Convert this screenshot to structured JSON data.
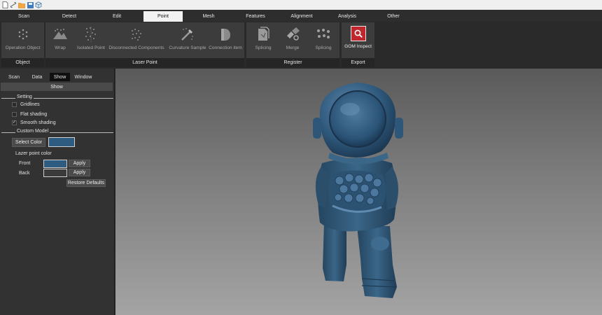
{
  "quick_access": [
    {
      "name": "new-file-icon"
    },
    {
      "name": "link-icon"
    },
    {
      "name": "open-folder-icon"
    },
    {
      "name": "save-icon"
    },
    {
      "name": "cube-icon"
    }
  ],
  "menu": {
    "tabs": [
      "Scan",
      "Detect",
      "Edit",
      "Point",
      "Mesh",
      "Features",
      "Alignment",
      "Analysis",
      "Other"
    ],
    "active": "Point"
  },
  "ribbon": {
    "groups": {
      "object": {
        "label": "Object",
        "tools": [
          {
            "label": "Operation Object",
            "icon": "operation-object-icon"
          }
        ]
      },
      "laser_point": {
        "label": "Laser Point",
        "tools": [
          {
            "label": "Wrap",
            "icon": "wrap-icon"
          },
          {
            "label": "Isolated Point",
            "icon": "isolated-point-icon"
          },
          {
            "label": "Disconnected Components",
            "icon": "disconnected-components-icon"
          },
          {
            "label": "Curvature Sample",
            "icon": "curvature-sample-icon"
          },
          {
            "label": "Connection item",
            "icon": "connection-item-icon"
          }
        ]
      },
      "register": {
        "label": "Register",
        "tools": [
          {
            "label": "Splicing",
            "icon": "splicing-doc-icon"
          },
          {
            "label": "Merge",
            "icon": "merge-icon"
          },
          {
            "label": "Splicing",
            "icon": "splicing-points-icon"
          }
        ]
      },
      "export": {
        "label": "Export",
        "tools": [
          {
            "label": "GOM Inspect",
            "icon": "gom-inspect-icon"
          }
        ]
      }
    }
  },
  "panel": {
    "tabs": [
      "Scan",
      "Data",
      "Show",
      "Window"
    ],
    "active_tab": "Show",
    "header": "Show",
    "setting": {
      "title": "Setting",
      "options": [
        {
          "label": "Gridlines",
          "checked": false
        },
        {
          "label": "Flat shading",
          "checked": false
        },
        {
          "label": "Smooth shading",
          "checked": true
        }
      ]
    },
    "custom_model": {
      "title": "Custom Model",
      "select_color_label": "Select Color",
      "model_color": "#2d5c80",
      "lazer_title": "Lazer point color",
      "front_label": "Front",
      "front_color": "#2d5c80",
      "back_label": "Back",
      "back_color": "#3a3a3a",
      "apply_label": "Apply",
      "restore_label": "Restore Defaults"
    }
  },
  "colors": {
    "model": "#2f5a7d",
    "accent_red": "#c0272d"
  }
}
